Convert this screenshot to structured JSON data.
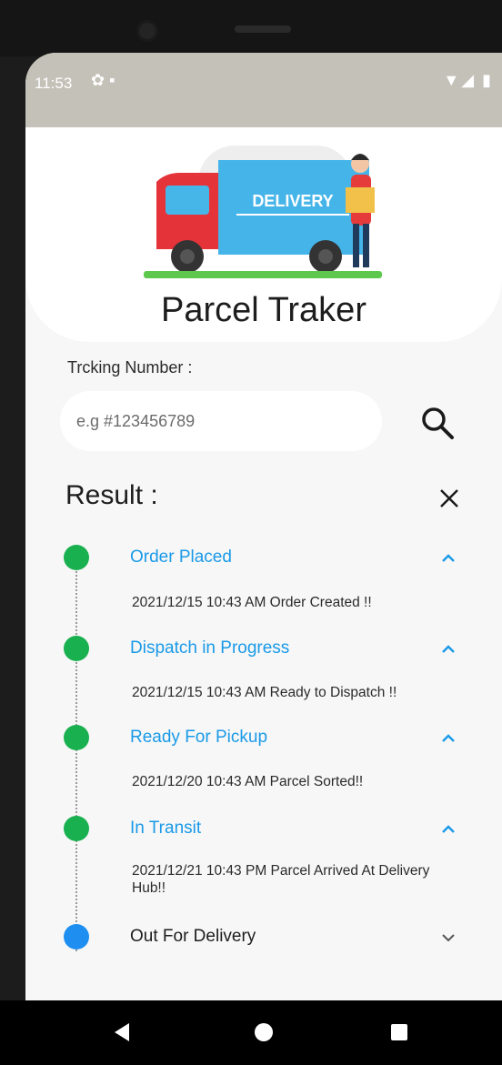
{
  "status_bar": {
    "time": "11:53",
    "left_icons": "✿ ▪",
    "right_icons": "▼◢ ▮"
  },
  "app": {
    "title": "Parcel Traker",
    "truck_label": "DELIVERY"
  },
  "search": {
    "label": "Trcking Number :",
    "placeholder": "e.g #123456789",
    "value": ""
  },
  "result": {
    "title": "Result :"
  },
  "colors": {
    "accent_blue": "#1a9ae8",
    "dot_green": "#19b04f",
    "dot_blue": "#1e8ff0"
  },
  "timeline": [
    {
      "step": "Order Placed",
      "detail": "2021/12/15 10:43 AM Order Created !!",
      "state": "done",
      "expanded": true
    },
    {
      "step": "Dispatch in Progress",
      "detail": "2021/12/15 10:43 AM Ready to Dispatch !!",
      "state": "done",
      "expanded": true
    },
    {
      "step": "Ready For Pickup",
      "detail": "2021/12/20 10:43 AM Parcel Sorted!!",
      "state": "done",
      "expanded": true
    },
    {
      "step": "In Transit",
      "detail": "2021/12/21 10:43 PM Parcel Arrived At Delivery Hub!!",
      "state": "done",
      "expanded": true
    },
    {
      "step": "Out For Delivery",
      "detail": "",
      "state": "current",
      "expanded": false
    }
  ]
}
